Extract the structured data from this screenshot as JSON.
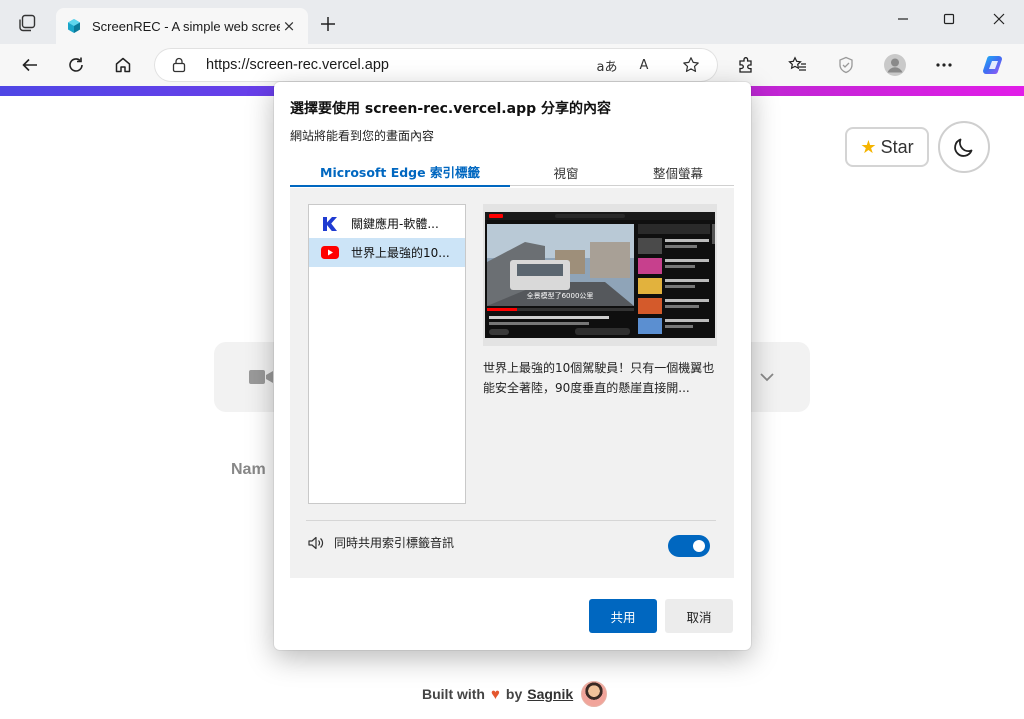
{
  "browser": {
    "tab_title": "ScreenREC - A simple web screen recorder",
    "tab_close": "×",
    "new_tab": "+",
    "url": "https://screen-rec.vercel.app",
    "read_aloud_label": "aあ",
    "text_size_label": "A",
    "window_controls": [
      "minimize",
      "maximize",
      "close"
    ],
    "icons": [
      "workspaces-icon",
      "back-icon",
      "refresh-icon",
      "home-icon",
      "lock-icon",
      "star-icon",
      "extensions-icon",
      "favorites-icon",
      "browser-essentials-icon",
      "profile-icon",
      "more-icon",
      "copilot-icon"
    ]
  },
  "page": {
    "star_label": "Star",
    "name_label": "Nam",
    "footer_built": "Built with",
    "footer_by": "by",
    "footer_author": "Sagnik"
  },
  "dialog": {
    "title": "選擇要使用 screen-rec.vercel.app 分享的內容",
    "subtitle": "網站將能看到您的畫面內容",
    "tabs": [
      {
        "label": "Microsoft Edge 索引標籤",
        "active": true
      },
      {
        "label": "視窗",
        "active": false
      },
      {
        "label": "整個螢幕",
        "active": false
      }
    ],
    "tab_items": [
      {
        "label": "關鍵應用-軟體...",
        "icon": "k-site-icon",
        "selected": false
      },
      {
        "label": "世界上最強的10...",
        "icon": "youtube-icon",
        "selected": true
      }
    ],
    "preview_caption": "世界上最強的10個駕駛員！只有一個機翼也能安全著陸，90度垂直的懸崖直接開...",
    "preview_overlay_text": "全景模型了6000公里",
    "audio_label": "同時共用索引標籤音訊",
    "audio_enabled": true,
    "share_button": "共用",
    "cancel_button": "取消"
  },
  "colors": {
    "accent": "#0067c0",
    "gradient_start": "#4f46e5",
    "gradient_end": "#e11de8",
    "selected_item": "#cce4f7",
    "youtube_red": "#ff0000",
    "heart": "#e4572e"
  }
}
